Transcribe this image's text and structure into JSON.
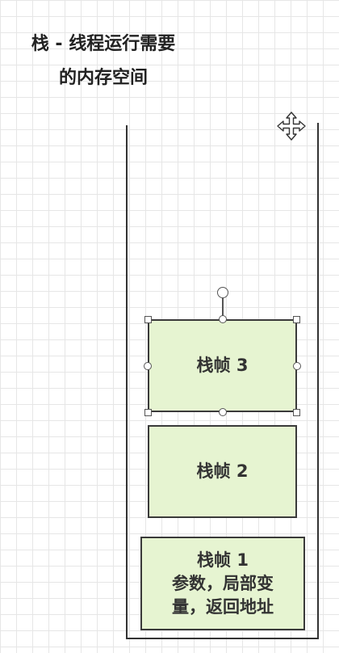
{
  "title": {
    "line1": "栈 - 线程运行需要",
    "line2": "的内存空间"
  },
  "frames": [
    {
      "label": "栈帧 3"
    },
    {
      "label": "栈帧 2"
    },
    {
      "label": "栈帧 1",
      "detail_line1": "参数，局部变",
      "detail_line2": "量，返回地址"
    }
  ],
  "colors": {
    "frame_fill": "#e6f4d1",
    "frame_border": "#3a3a3a",
    "grid": "#e6e6e6"
  },
  "icons": {
    "cursor": "move-cursor-icon"
  }
}
